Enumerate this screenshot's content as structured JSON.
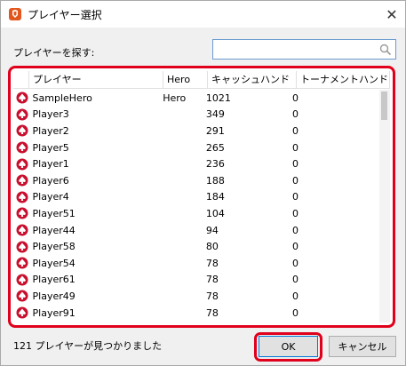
{
  "window": {
    "title": "プレイヤー選択",
    "close_glyph": "✕",
    "app_icon": "holdem-manager-icon"
  },
  "search": {
    "label": "プレイヤーを探す:",
    "value": "",
    "placeholder": ""
  },
  "table": {
    "columns": [
      "プレイヤー",
      "Hero",
      "キャッシュハンド",
      "トーナメントハンド"
    ],
    "rows": [
      {
        "name": "SampleHero",
        "hero": "Hero",
        "cash": "1021",
        "tour": "0"
      },
      {
        "name": "Player3",
        "hero": "",
        "cash": "349",
        "tour": "0"
      },
      {
        "name": "Player2",
        "hero": "",
        "cash": "291",
        "tour": "0"
      },
      {
        "name": "Player5",
        "hero": "",
        "cash": "265",
        "tour": "0"
      },
      {
        "name": "Player1",
        "hero": "",
        "cash": "236",
        "tour": "0"
      },
      {
        "name": "Player6",
        "hero": "",
        "cash": "188",
        "tour": "0"
      },
      {
        "name": "Player4",
        "hero": "",
        "cash": "184",
        "tour": "0"
      },
      {
        "name": "Player51",
        "hero": "",
        "cash": "104",
        "tour": "0"
      },
      {
        "name": "Player44",
        "hero": "",
        "cash": "94",
        "tour": "0"
      },
      {
        "name": "Player58",
        "hero": "",
        "cash": "80",
        "tour": "0"
      },
      {
        "name": "Player54",
        "hero": "",
        "cash": "78",
        "tour": "0"
      },
      {
        "name": "Player61",
        "hero": "",
        "cash": "78",
        "tour": "0"
      },
      {
        "name": "Player49",
        "hero": "",
        "cash": "78",
        "tour": "0"
      },
      {
        "name": "Player91",
        "hero": "",
        "cash": "78",
        "tour": "0"
      },
      {
        "name": "Player50",
        "hero": "",
        "cash": "78",
        "tour": "0"
      },
      {
        "name": "Player60",
        "hero": "",
        "cash": "64",
        "tour": "0"
      }
    ],
    "row_icon": "pokerstars-spade-icon"
  },
  "status": {
    "text": "121 プレイヤーが見つかりました"
  },
  "buttons": {
    "ok": "OK",
    "cancel": "キャンセル"
  },
  "colors": {
    "highlight": "#e0001b",
    "accent": "#0078d7"
  }
}
